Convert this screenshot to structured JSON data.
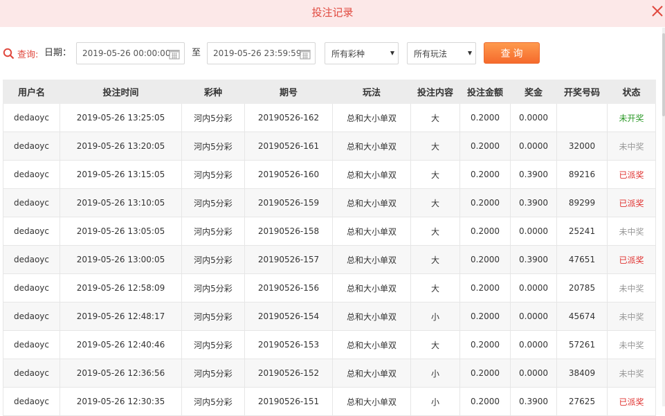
{
  "dialog": {
    "title": "投注记录"
  },
  "filters": {
    "search_label": "查询:",
    "date_label": "日期：",
    "date_from": "2019-05-26 00:00:00",
    "to_label": "至",
    "date_to": "2019-05-26 23:59:59",
    "lottery_select": "所有彩种",
    "play_select": "所有玩法",
    "query_button": "查询"
  },
  "table": {
    "headers": [
      "用户名",
      "投注时间",
      "彩种",
      "期号",
      "玩法",
      "投注内容",
      "投注金额",
      "奖金",
      "开奖号码",
      "状态"
    ],
    "rows": [
      [
        "dedaoyc",
        "2019-05-26 13:25:05",
        "河内5分彩",
        "20190526-162",
        "总和大小单双",
        "大",
        "0.2000",
        "0.0000",
        "",
        "未开奖"
      ],
      [
        "dedaoyc",
        "2019-05-26 13:20:05",
        "河内5分彩",
        "20190526-161",
        "总和大小单双",
        "大",
        "0.2000",
        "0.0000",
        "32000",
        "未中奖"
      ],
      [
        "dedaoyc",
        "2019-05-26 13:15:05",
        "河内5分彩",
        "20190526-160",
        "总和大小单双",
        "大",
        "0.2000",
        "0.3900",
        "89216",
        "已派奖"
      ],
      [
        "dedaoyc",
        "2019-05-26 13:10:05",
        "河内5分彩",
        "20190526-159",
        "总和大小单双",
        "大",
        "0.2000",
        "0.3900",
        "89299",
        "已派奖"
      ],
      [
        "dedaoyc",
        "2019-05-26 13:05:05",
        "河内5分彩",
        "20190526-158",
        "总和大小单双",
        "大",
        "0.2000",
        "0.0000",
        "25241",
        "未中奖"
      ],
      [
        "dedaoyc",
        "2019-05-26 13:00:05",
        "河内5分彩",
        "20190526-157",
        "总和大小单双",
        "大",
        "0.2000",
        "0.3900",
        "47651",
        "已派奖"
      ],
      [
        "dedaoyc",
        "2019-05-26 12:58:09",
        "河内5分彩",
        "20190526-156",
        "总和大小单双",
        "大",
        "0.2000",
        "0.0000",
        "20785",
        "未中奖"
      ],
      [
        "dedaoyc",
        "2019-05-26 12:48:17",
        "河内5分彩",
        "20190526-154",
        "总和大小单双",
        "小",
        "0.2000",
        "0.0000",
        "45674",
        "未中奖"
      ],
      [
        "dedaoyc",
        "2019-05-26 12:40:46",
        "河内5分彩",
        "20190526-153",
        "总和大小单双",
        "大",
        "0.2000",
        "0.0000",
        "57261",
        "未中奖"
      ],
      [
        "dedaoyc",
        "2019-05-26 12:36:56",
        "河内5分彩",
        "20190526-152",
        "总和大小单双",
        "小",
        "0.2000",
        "0.0000",
        "38409",
        "未中奖"
      ],
      [
        "dedaoyc",
        "2019-05-26 12:30:35",
        "河内5分彩",
        "20190526-151",
        "总和大小单双",
        "小",
        "0.2000",
        "0.3900",
        "27625",
        "已派奖"
      ]
    ]
  },
  "colors": {
    "accent": "#e0483e",
    "header_bg": "#fce8e8",
    "status_open": "#2e9a2a",
    "status_miss": "#999999",
    "status_paid": "#e0302e",
    "button": "#f56a2c"
  },
  "icons": {
    "close": "close-icon",
    "search": "search-icon",
    "calendar": "calendar-icon",
    "dropdown": "chevron-down-icon"
  }
}
